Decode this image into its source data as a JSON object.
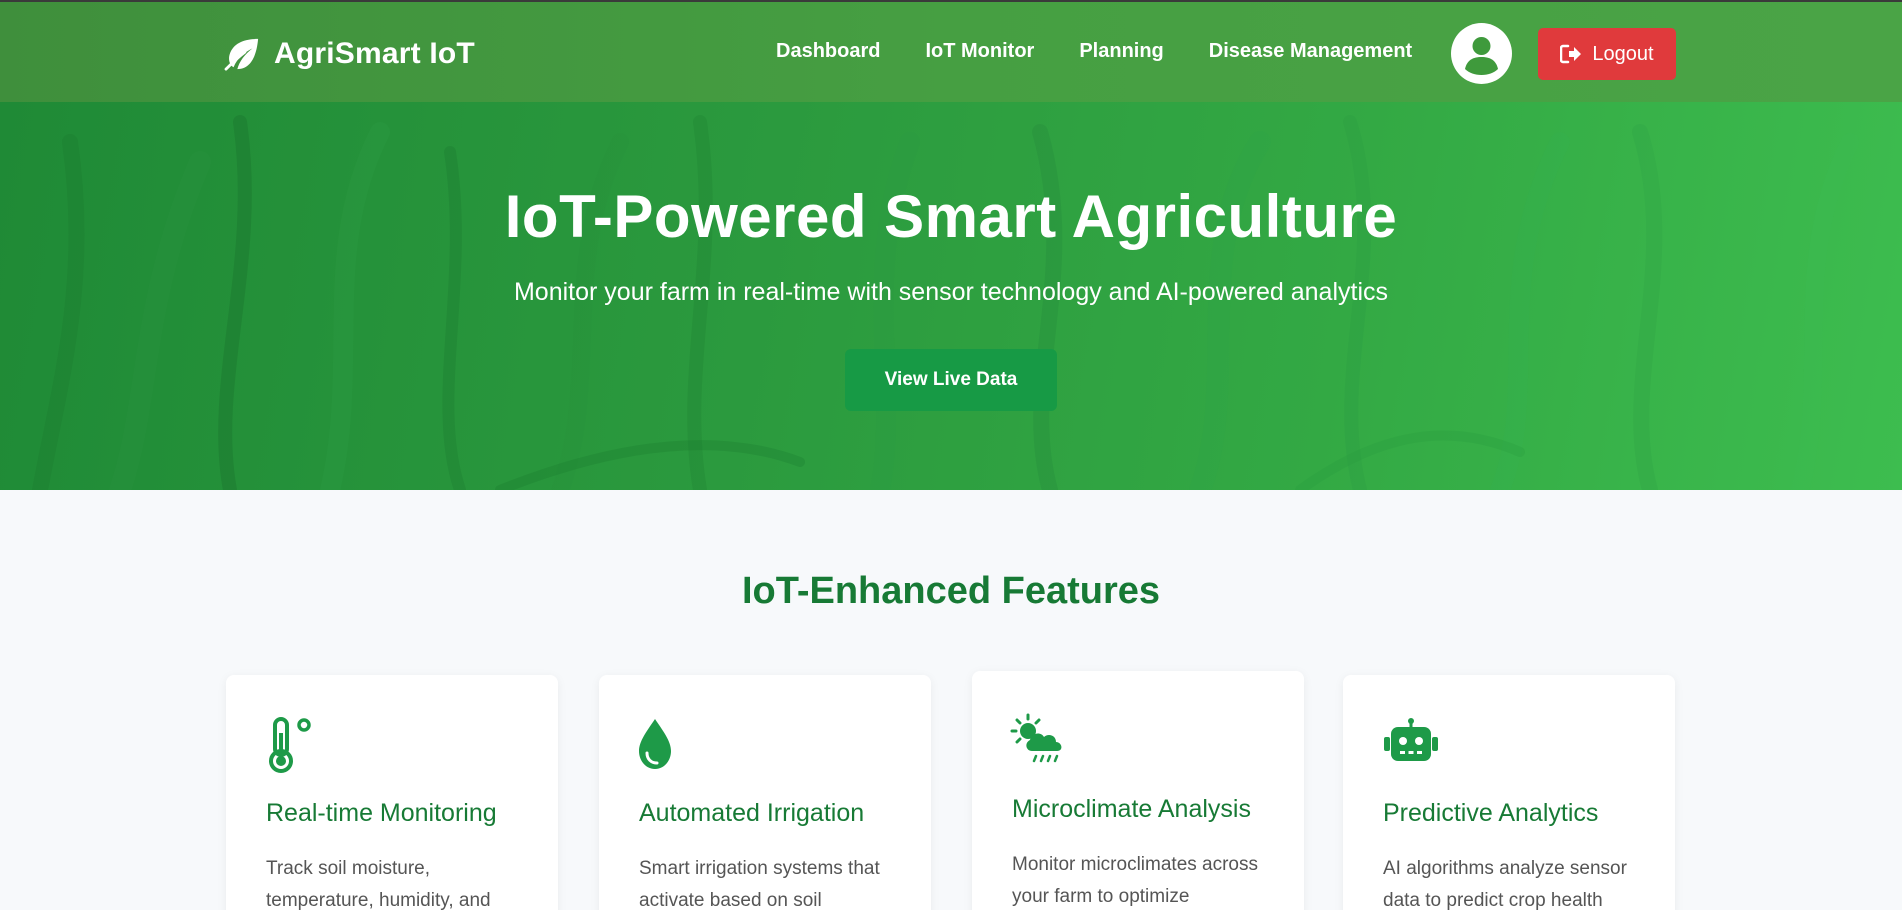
{
  "navbar": {
    "brand": "AgriSmart IoT",
    "links": [
      "Dashboard",
      "IoT Monitor",
      "Planning",
      "Disease Management"
    ],
    "logout_label": "Logout"
  },
  "hero": {
    "title": "IoT-Powered Smart Agriculture",
    "subtitle": "Monitor your farm in real-time with sensor technology and AI-powered analytics",
    "button_label": "View Live Data"
  },
  "features": {
    "title": "IoT-Enhanced Features",
    "cards": [
      {
        "icon": "thermometer-icon",
        "title": "Real-time Monitoring",
        "description": "Track soil moisture, temperature, humidity, and"
      },
      {
        "icon": "water-drop-icon",
        "title": "Automated Irrigation",
        "description": "Smart irrigation systems that activate based on soil"
      },
      {
        "icon": "cloud-sun-rain-icon",
        "title": "Microclimate Analysis",
        "description": "Monitor microclimates across your farm to optimize"
      },
      {
        "icon": "robot-icon",
        "title": "Predictive Analytics",
        "description": "AI algorithms analyze sensor data to predict crop health"
      }
    ]
  },
  "colors": {
    "navbar": "#469f42",
    "accent_green": "#177a35",
    "button_green": "#179a45",
    "logout_red": "#e03a3c"
  }
}
